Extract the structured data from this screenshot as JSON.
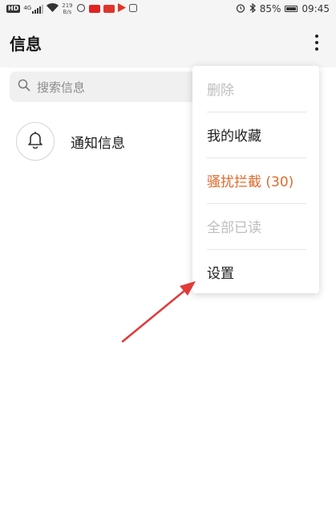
{
  "status_bar": {
    "hd_label": "HD",
    "signal_label": "4G",
    "net_speed_value": "219",
    "net_speed_unit": "B/s",
    "battery_percent": "85%",
    "time": "09:45"
  },
  "header": {
    "title": "信息"
  },
  "search": {
    "placeholder": "搜索信息"
  },
  "list": {
    "items": [
      {
        "label": "通知信息",
        "icon": "bell-icon"
      }
    ]
  },
  "menu": {
    "items": [
      {
        "label": "删除",
        "state": "disabled"
      },
      {
        "label": "我的收藏",
        "state": "normal"
      },
      {
        "label": "骚扰拦截 (30)",
        "state": "accent"
      },
      {
        "label": "全部已读",
        "state": "disabled"
      },
      {
        "label": "设置",
        "state": "normal"
      }
    ]
  },
  "colors": {
    "accent": "#e06a2c",
    "disabled": "#bdbdbd",
    "annotation_arrow": "#e03a3a",
    "header_bg": "#f5f5f5"
  }
}
